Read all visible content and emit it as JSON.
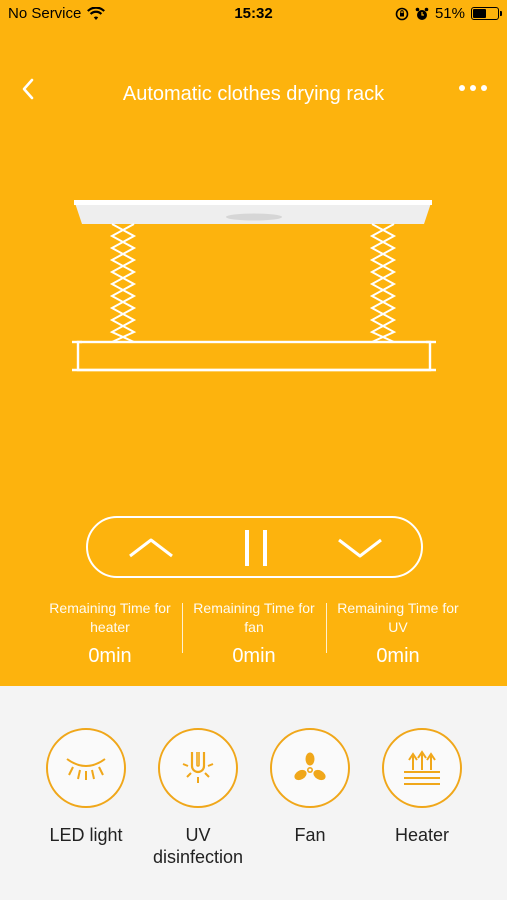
{
  "status": {
    "carrier": "No Service",
    "time": "15:32",
    "battery": "51%",
    "battery_level": 0.51
  },
  "nav": {
    "title": "Automatic clothes drying rack",
    "back_icon": "chevron-left-icon",
    "more_icon": "more-horizontal-icon"
  },
  "controls": {
    "up_icon": "chevron-up-icon",
    "pause_icon": "pause-icon",
    "down_icon": "chevron-down-icon"
  },
  "timers": [
    {
      "label": "Remaining Time for heater",
      "value": "0min"
    },
    {
      "label": "Remaining Time for fan",
      "value": "0min"
    },
    {
      "label": "Remaining Time for UV",
      "value": "0min"
    }
  ],
  "features": [
    {
      "label": "LED light",
      "icon": "led-light-icon"
    },
    {
      "label": "UV disinfection",
      "icon": "uv-lamp-icon"
    },
    {
      "label": "Fan",
      "icon": "fan-icon"
    },
    {
      "label": "Heater",
      "icon": "heater-icon"
    }
  ],
  "colors": {
    "primary": "#fdb30d",
    "accent": "#f0a71a",
    "background": "#f4f4f4"
  }
}
